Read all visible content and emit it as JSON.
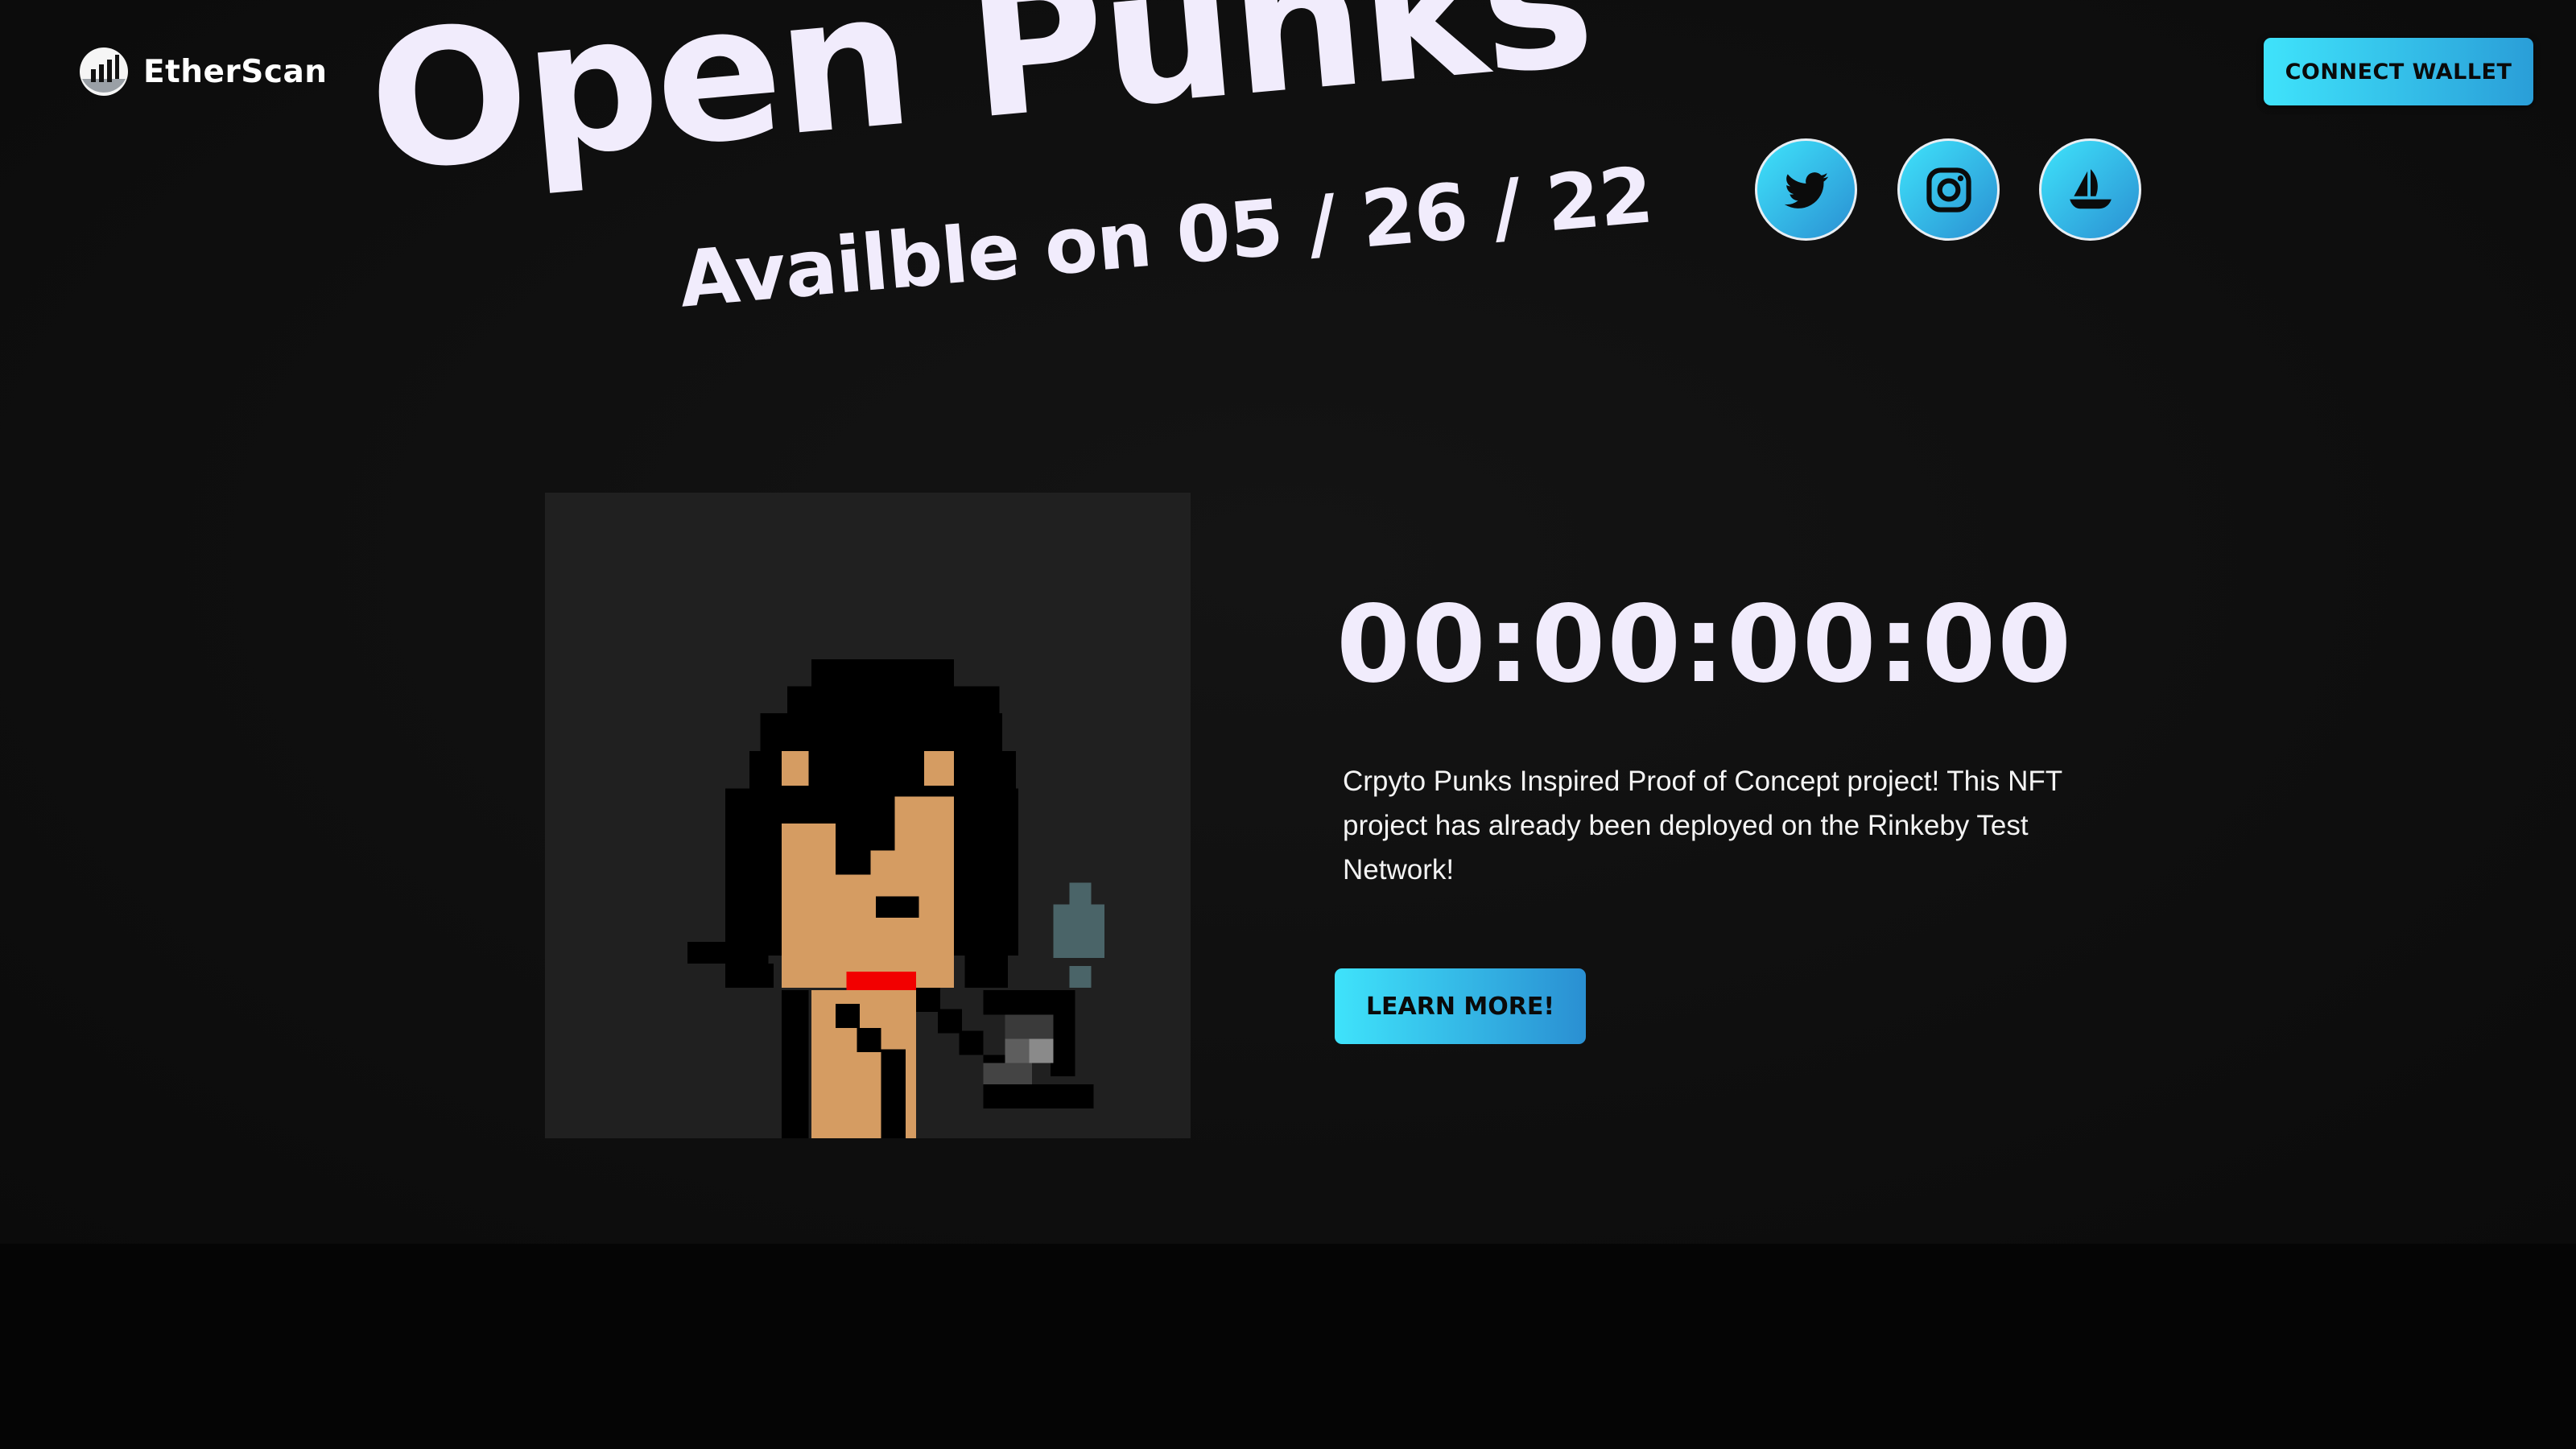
{
  "brand": {
    "name": "EtherScan",
    "logo_icon": "etherscan-logo-icon"
  },
  "header": {
    "connect_label": "CONNECT WALLET"
  },
  "hero": {
    "title": "Open Punks",
    "subtitle": "Availble on 05 / 26 / 22"
  },
  "social": [
    {
      "name": "twitter-icon"
    },
    {
      "name": "instagram-icon"
    },
    {
      "name": "opensea-icon"
    }
  ],
  "countdown": "00:00:00:00",
  "description": "Crpyto Punks Inspired Proof of Concept project! This NFT project has already been deployed on the Rinkeby Test Network!",
  "learn_label": "LEARN MORE!",
  "colors": {
    "accent_start": "#3fe3fb",
    "accent_end": "#2a8fd2",
    "title_text": "#f1ecfc",
    "background": "#0f0f0f"
  }
}
